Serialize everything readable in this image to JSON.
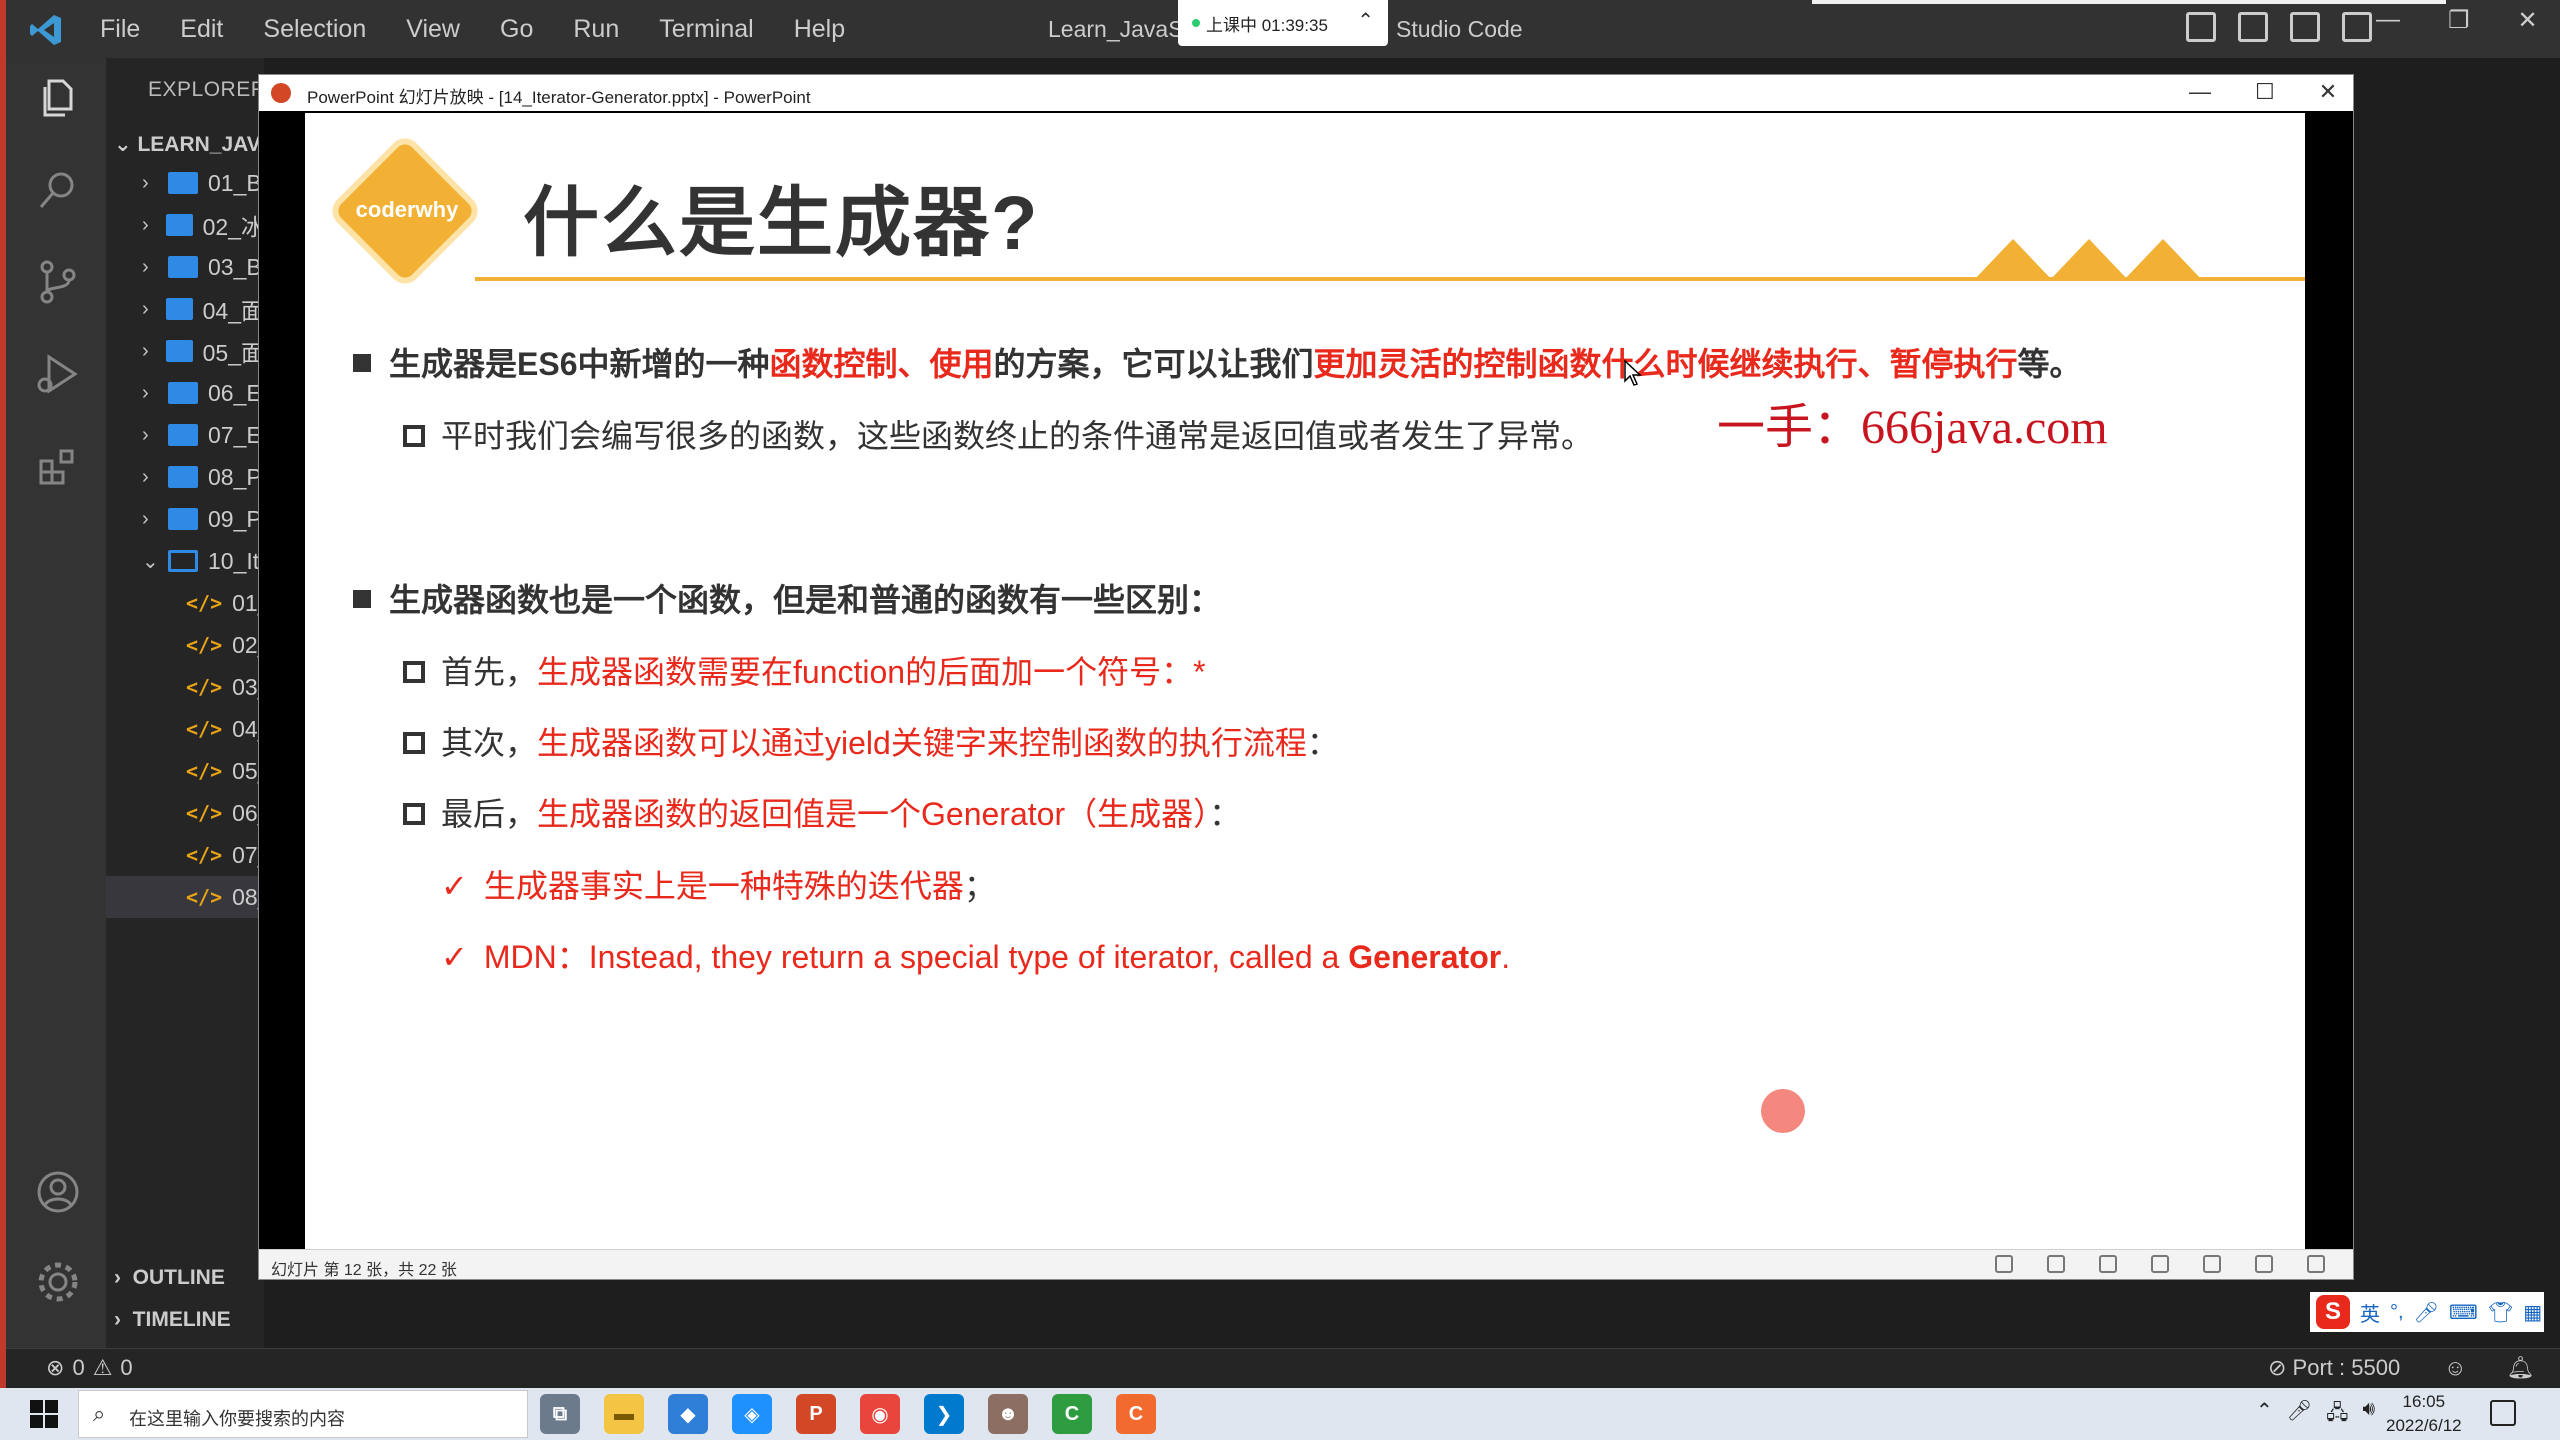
{
  "vscode": {
    "menu": [
      "File",
      "Edit",
      "Selection",
      "View",
      "Go",
      "Run",
      "Terminal",
      "Help"
    ],
    "title_left": "Learn_JavaSc",
    "title_right": "Studio Code",
    "recording": "上课中 01:39:35",
    "explorer_title": "EXPLORER",
    "project_root": "LEARN_JAVA",
    "folders": [
      "01_B",
      "02_冰",
      "03_B",
      "04_面",
      "05_面",
      "06_E",
      "07_E",
      "08_P",
      "09_P",
      "10_It"
    ],
    "files": [
      "01_",
      "02_",
      "03_",
      "04_",
      "05_",
      "06_",
      "07_",
      "08_"
    ],
    "outline": "OUTLINE",
    "timeline": "TIMELINE",
    "status": {
      "errors": "0",
      "warnings": "0",
      "port": "Port : 5500"
    }
  },
  "powerpoint": {
    "window_title": "PowerPoint 幻灯片放映 - [14_Iterator-Generator.pptx] - PowerPoint",
    "status_text": "幻灯片 第 12 张，共 22 张",
    "slide": {
      "logo": "coderwhy",
      "title": "什么是生成器?",
      "b1_a": "生成器是ES6中新增的一种",
      "b1_b": "函数控制、使用",
      "b1_c": "的方案，它可以让我们",
      "b1_d": "更加灵活的控制函数什么时候继续执行、暂停执行",
      "b1_e": "等。",
      "b1_sub": "平时我们会编写很多的函数，这些函数终止的条件通常是返回值或者发生了异常。",
      "watermark": "一手：666java.com",
      "b2": "生成器函数也是一个函数，但是和普通的函数有一些区别：",
      "b2_s1_a": "首先，",
      "b2_s1_b": "生成器函数需要在function的后面加一个符号：*",
      "b2_s2_a": "其次，",
      "b2_s2_b": "生成器函数可以通过yield关键字来控制函数的执行流程",
      "b2_s2_c": "：",
      "b2_s3_a": "最后，",
      "b2_s3_b": "生成器函数的返回值是一个Generator（生成器）",
      "b2_s3_c": "：",
      "c1": "生成器事实上是一种特殊的迭代器",
      "c1_end": "；",
      "c2_a": "MDN：Instead, they return a special type of iterator, called a ",
      "c2_b": "Generator",
      "c2_c": "."
    }
  },
  "ime": {
    "lang": "英"
  },
  "taskbar": {
    "search_placeholder": "在这里输入你要搜索的内容",
    "time": "16:05",
    "date": "2022/6/12"
  },
  "colors": {
    "accent_red": "#e8291c",
    "accent_yellow": "#f2b134",
    "vscode_blue": "#2f8ae6"
  }
}
